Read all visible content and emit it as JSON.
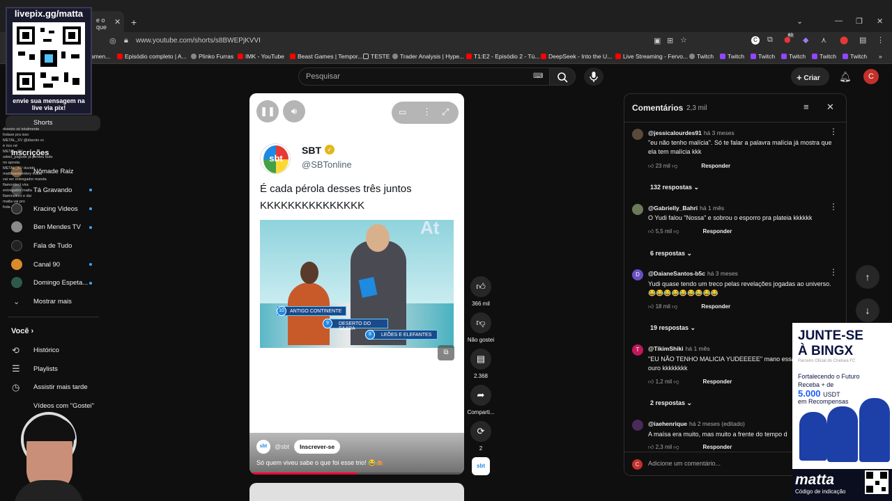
{
  "browser": {
    "tab_active_label": "e o que",
    "new_tab": "+",
    "url": "www.youtube.com/shorts/s8BWEPjKVVI",
    "ext_badge": "63",
    "bookmarks": [
      "amen...",
      "Episódio completo | A...",
      "Plinko Furras",
      "IMK - YouTube",
      "Beast Games | Tempor...",
      "TESTE",
      "Trader Analysis | Hype...",
      "T1:E2 - Episódio 2 - Tú...",
      "DeepSeek - Into the U...",
      "Live Streaming - Fervo...",
      "Twitch",
      "Twitch",
      "Twitch",
      "Twitch",
      "Twitch",
      "Twitch"
    ]
  },
  "youtube": {
    "search_placeholder": "Pesquisar",
    "create_label": "Criar",
    "avatar_letter": "C",
    "sidebar": {
      "shorts": "Shorts",
      "subscriptions_header": "Inscrições",
      "channels": [
        "Nômade Raiz",
        "Tá Gravando",
        "Kracing Videos",
        "Ben Mendes TV",
        "Fala de Tudo",
        "Canal 90",
        "Domingo Espeta..."
      ],
      "show_more": "Mostrar mais",
      "you_header": "Você",
      "you_items": [
        "Histórico",
        "Playlists",
        "Assistir mais tarde",
        "Vídeos com \"Gostei\""
      ]
    },
    "short": {
      "account_name": "SBT",
      "handle": "@SBTonline",
      "post_text_line1": "É cada pérola desses três juntos",
      "post_text_line2": "KKKKKKKKKKKKKKK",
      "tv_captions": [
        "ANTIGO CONTINENTE",
        "DESERTO DO SAARA",
        "LEÕES E ELEFANTES"
      ],
      "tv_numbers": [
        "10",
        "9",
        "8"
      ],
      "channel": "@sbt",
      "subscribe_label": "Inscrever-se",
      "title": "Só quem viveu sabe o que foi esse trio! 😂🙈",
      "logo_text": "sbt"
    },
    "actions": {
      "likes": "366 mil",
      "dislike": "Não gostei",
      "comments": "2.368",
      "share": "Comparti...",
      "remix": "2"
    },
    "comments": {
      "title": "Comentários",
      "count": "2,3 mil",
      "reply_label": "Responder",
      "add_placeholder": "Adicione um comentário...",
      "items": [
        {
          "user": "@jessicalourdes91",
          "time": "há 3 meses",
          "text": "\"eu não tenho malícia\". Só te falar a palavra malícia já mostra que ela tem malícia kkk",
          "likes": "23 mil",
          "replies": "132 respostas",
          "avatar_color": "#5b4a3a",
          "letter": ""
        },
        {
          "user": "@Gabrielly_Bahri",
          "time": "há 1 mês",
          "text": "O Yudi falou \"Nossa\" e sobrou o esporro pra plateia kkkkkk",
          "likes": "5,5 mil",
          "replies": "6 respostas",
          "avatar_color": "#6b7b5a",
          "letter": ""
        },
        {
          "user": "@DaianeSantos-b5c",
          "time": "há 3 meses",
          "text": "Yudi quase tendo um treco pelas revelações jogadas ao universo. 😂😂😂😂😂😂😂😂😂",
          "likes": "18 mil",
          "replies": "19 respostas",
          "avatar_color": "#6a4fc4",
          "letter": "D"
        },
        {
          "user": "@TikimShiki",
          "time": "há 1 mês",
          "text": "\"EU NÃO TENHO MALICIA YUDEEEEE\" mano essa ouro kkkkkkkk",
          "likes": "1,2 mil",
          "replies": "2 respostas",
          "avatar_color": "#c2185b",
          "letter": "T"
        },
        {
          "user": "@iaehenrique",
          "time": "há 2 meses (editado)",
          "text": "A maísa era muito, mas muito a frente do tempo d",
          "likes": "2,3 mil",
          "replies": "",
          "avatar_color": "#4a2a5a",
          "letter": ""
        }
      ]
    }
  },
  "overlays": {
    "qr_title": "livepix.gg/matta",
    "qr_caption": "envie sua mensagem na live via pix!",
    "chat_lines": [
      "diasoto  só totalmente",
      "fodase pra isso",
      "METAL_XV  @diaroto vc",
      "é rico né",
      "METAL_XV",
      "odeio_pagode  já perdeu tudo",
      "no aposta",
      "METAL_XV  duvido",
      "maldivasmonkey  matta",
      "vai ver entregador manda",
      "flamnstinct  vira",
      "entregador matta",
      "flaminstinct  e dai",
      "matta  vai pro",
      "foda"
    ],
    "ad": {
      "headline1": "JUNTE-SE",
      "headline2": "À BINGX",
      "partner": "Parceiro Oficial do Chelsea FC",
      "line1": "Fortalecendo o Futuro",
      "line2": "Receba + de",
      "amount": "5.000",
      "currency": "USDT",
      "line3": "em Recompensas",
      "brand": "matta",
      "code_label": "Código de indicação"
    }
  },
  "colors": {
    "bg": "#0f0f0f",
    "accent_red": "#ff0033",
    "link_blue": "#3ea6ff"
  }
}
